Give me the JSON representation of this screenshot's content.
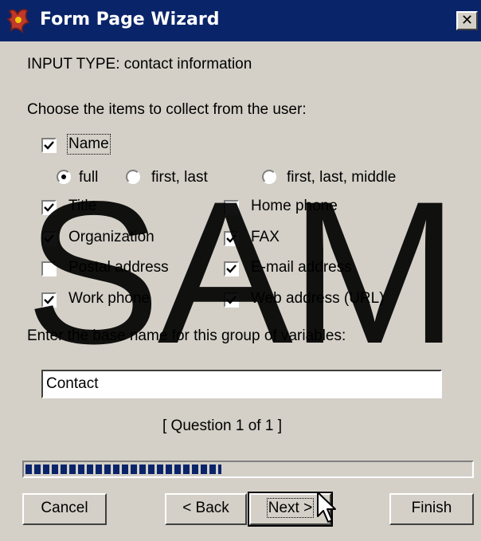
{
  "window": {
    "title": "Form Page Wizard",
    "close_label": "✕",
    "app_icon": "frontpage-app-icon"
  },
  "header": {
    "input_type": "INPUT TYPE: contact information",
    "instruction": "Choose the items to collect from the user:"
  },
  "name_option": {
    "label": "Name",
    "checked": true,
    "radios": [
      {
        "label": "full",
        "selected": true
      },
      {
        "label": "first, last",
        "selected": false
      },
      {
        "label": "first, last, middle",
        "selected": false
      }
    ]
  },
  "items_left": [
    {
      "label": "Title",
      "checked": true
    },
    {
      "label": "Organization",
      "checked": true
    },
    {
      "label": "Postal address",
      "checked": false
    },
    {
      "label": "Work phone",
      "checked": true
    }
  ],
  "items_right": [
    {
      "label": "Home phone",
      "checked": false
    },
    {
      "label": "FAX",
      "checked": true
    },
    {
      "label": "E-mail address",
      "checked": true
    },
    {
      "label": "Web address (URL)",
      "checked": true
    }
  ],
  "basename": {
    "prompt": "Enter the base name for this group of variables:",
    "value": "Contact"
  },
  "question_counter": "[ Question 1 of 1 ]",
  "progress": {
    "fraction": 0.44
  },
  "buttons": {
    "cancel": "Cancel",
    "back": "< Back",
    "next": "Next >",
    "finish": "Finish"
  },
  "watermark": "SAM",
  "colors": {
    "face": "#d4d0c8",
    "titlebar": "#0a246a",
    "progress": "#0a246a"
  }
}
